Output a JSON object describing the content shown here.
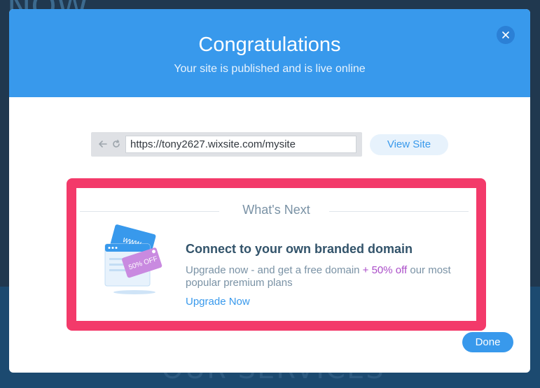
{
  "background": {
    "heading_fragment": "NOW",
    "section_heading": "OUR SERVICES"
  },
  "modal": {
    "title": "Congratulations",
    "subtitle": "Your site is published and is live online",
    "close_icon": "close-icon",
    "url": "https://tony2627.wixsite.com/mysite",
    "view_site_label": "View Site",
    "whats_next_label": "What's Next",
    "card": {
      "title": "Connect to your own branded domain",
      "desc_part1": "Upgrade now - and get a free domain ",
      "desc_promo": "+ 50% off",
      "desc_part2": " our most popular premium plans",
      "illustration_www": "www",
      "illustration_tag": "50% OFF",
      "upgrade_label": "Upgrade Now"
    },
    "done_label": "Done"
  },
  "colors": {
    "header": "#3899ec",
    "highlight": "#f33a6a",
    "promo": "#aa4dc8",
    "accent": "#3899ec"
  }
}
